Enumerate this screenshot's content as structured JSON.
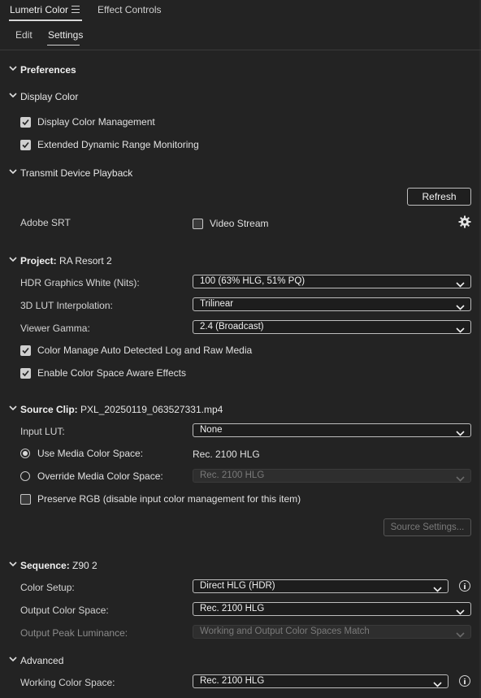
{
  "tabs": {
    "lumetri_color": "Lumetri Color",
    "effect_controls": "Effect Controls"
  },
  "subtabs": {
    "edit": "Edit",
    "settings": "Settings"
  },
  "preferences": {
    "title": "Preferences"
  },
  "display_color": {
    "title": "Display Color",
    "display_color_management": "Display Color Management",
    "extended_dynamic_range": "Extended Dynamic Range Monitoring"
  },
  "transmit": {
    "title": "Transmit Device Playback",
    "refresh_label": "Refresh",
    "adobe_srt": "Adobe SRT",
    "video_stream": "Video Stream"
  },
  "project": {
    "title_bold": "Project:",
    "title_value": " RA Resort 2",
    "hdr_white_label": "HDR Graphics White (Nits):",
    "hdr_white_value": "100 (63% HLG, 51% PQ)",
    "lut_interp_label": "3D LUT Interpolation:",
    "lut_interp_value": "Trilinear",
    "viewer_gamma_label": "Viewer Gamma:",
    "viewer_gamma_value": "2.4 (Broadcast)",
    "auto_detect": "Color Manage Auto Detected Log and Raw Media",
    "color_space_aware": "Enable Color Space Aware Effects"
  },
  "source_clip": {
    "title_bold": "Source Clip:",
    "title_value": " PXL_20250119_063527331.mp4",
    "input_lut_label": "Input LUT:",
    "input_lut_value": "None",
    "use_media_label": "Use Media Color Space:",
    "use_media_value": "Rec. 2100 HLG",
    "override_label": "Override Media Color Space:",
    "override_value": "Rec. 2100 HLG",
    "preserve_rgb": "Preserve RGB (disable input color management for this item)",
    "source_settings": "Source Settings..."
  },
  "sequence": {
    "title_bold": "Sequence:",
    "title_value": " Z90 2",
    "color_setup_label": "Color Setup:",
    "color_setup_value": "Direct HLG (HDR)",
    "output_cs_label": "Output Color Space:",
    "output_cs_value": "Rec. 2100 HLG",
    "peak_lum_label": "Output Peak Luminance:",
    "peak_lum_value": "Working and Output Color Spaces Match"
  },
  "advanced": {
    "title": "Advanced",
    "working_cs_label": "Working Color Space:",
    "working_cs_value": "Rec. 2100 HLG"
  },
  "colors": {
    "background": "#232323",
    "text": "#d6d6d6",
    "dropdown_bg": "#1d1d1d"
  },
  "icons": [
    "hamburger-menu-icon",
    "chevron-down-icon",
    "checkmark-icon",
    "gear-icon",
    "info-icon"
  ]
}
